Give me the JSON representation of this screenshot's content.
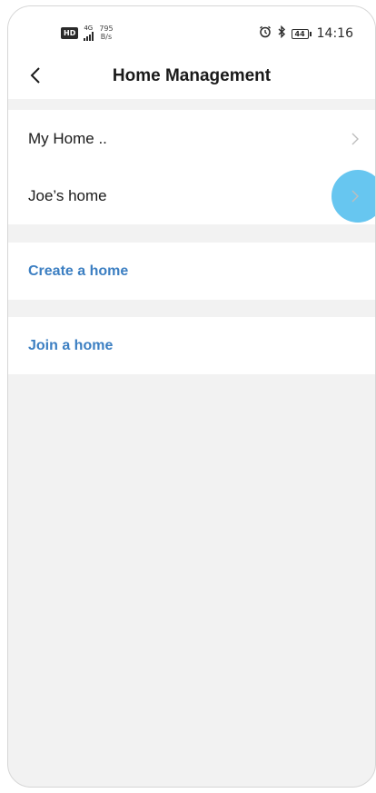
{
  "status_bar": {
    "hd": "HD",
    "network_type": "4G",
    "speed_value": "795",
    "speed_unit": "B/s",
    "battery": "44",
    "time": "14:16"
  },
  "header": {
    "title": "Home Management"
  },
  "homes": [
    {
      "label": "My Home .."
    },
    {
      "label": "Joe’s  home"
    }
  ],
  "actions": {
    "create_label": "Create a home",
    "join_label": "Join a home"
  },
  "colors": {
    "accent": "#3c7fc2",
    "background": "#f2f2f2",
    "touch_indicator": "#57c0ee",
    "chevron": "#bdbdbd"
  },
  "icons": {
    "back": "back-chevron-icon",
    "row_arrow": "chevron-right-icon",
    "alarm": "alarm-clock-icon",
    "bluetooth": "bluetooth-icon"
  }
}
